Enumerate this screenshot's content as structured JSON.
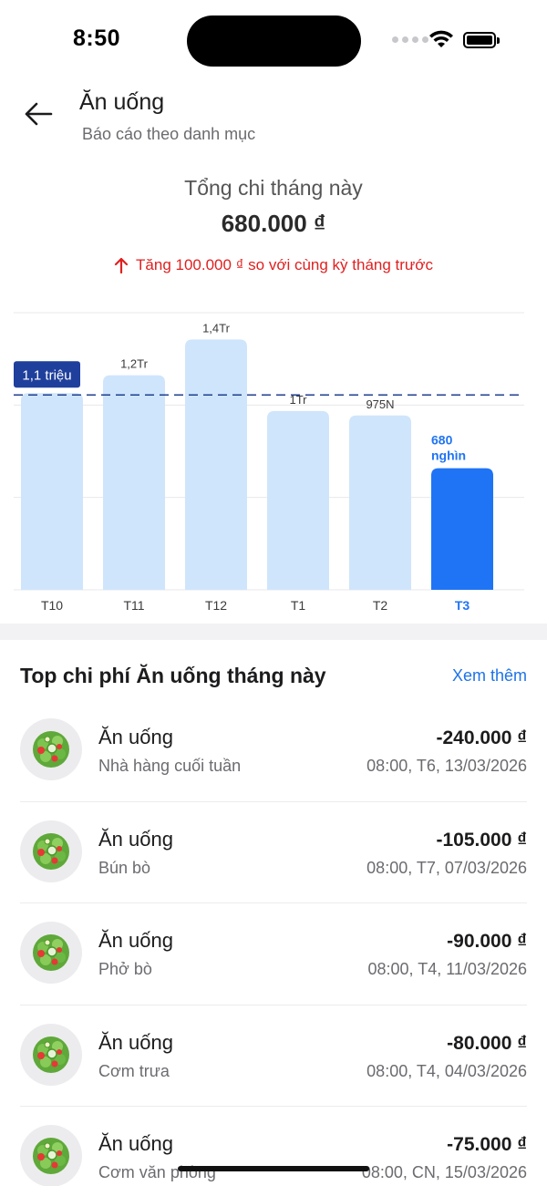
{
  "status_bar": {
    "time": "8:50"
  },
  "header": {
    "title": "Ăn uống",
    "subtitle": "Báo cáo theo danh mục"
  },
  "summary": {
    "label": "Tổng chi tháng này",
    "amount": "680.000 ₫",
    "change_text": "Tăng 100.000 ₫ so với cùng kỳ tháng trước",
    "change_color": "#e02020"
  },
  "chart_data": {
    "type": "bar",
    "categories": [
      "T10",
      "T11",
      "T12",
      "T1",
      "T2",
      "T3"
    ],
    "values": [
      1100000,
      1200000,
      1400000,
      1000000,
      975000,
      680000
    ],
    "value_labels": [
      "",
      "1,2Tr",
      "1,4Tr",
      "1Tr",
      "975N",
      "680 nghìn"
    ],
    "average": {
      "value": 1100000,
      "label": "1,1 triệu"
    },
    "ylim": [
      0,
      1550000
    ],
    "highlight_index": 5,
    "colors": {
      "bar": "#cfe5fc",
      "highlight": "#1f74f5",
      "average_line": "#1f3f8f",
      "average_badge": "#1f3f9c"
    },
    "grid": true
  },
  "top_section": {
    "title": "Top chi phí Ăn uống tháng này",
    "see_more": "Xem thêm"
  },
  "transactions": [
    {
      "category": "Ăn uống",
      "note": "Nhà hàng cuối tuần",
      "amount": "-240.000 ₫",
      "time": "08:00, T6, 13/03/2026",
      "icon": "salad-icon"
    },
    {
      "category": "Ăn uống",
      "note": "Bún bò",
      "amount": "-105.000 ₫",
      "time": "08:00, T7, 07/03/2026",
      "icon": "salad-icon"
    },
    {
      "category": "Ăn uống",
      "note": "Phở bò",
      "amount": "-90.000 ₫",
      "time": "08:00, T4, 11/03/2026",
      "icon": "salad-icon"
    },
    {
      "category": "Ăn uống",
      "note": "Cơm trưa",
      "amount": "-80.000 ₫",
      "time": "08:00, T4, 04/03/2026",
      "icon": "salad-icon"
    },
    {
      "category": "Ăn uống",
      "note": "Cơm văn phòng",
      "amount": "-75.000 ₫",
      "time": "08:00, CN, 15/03/2026",
      "icon": "salad-icon"
    }
  ]
}
